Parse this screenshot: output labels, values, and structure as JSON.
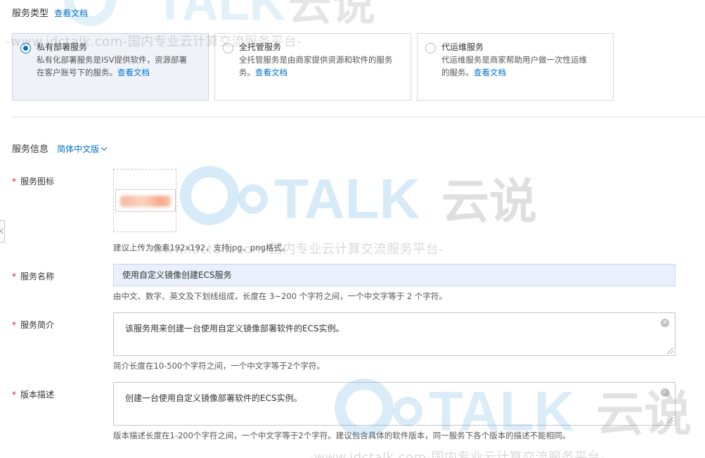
{
  "service_type": {
    "label": "服务类型",
    "doc_link": "查看文档",
    "options": [
      {
        "title": "私有部署服务",
        "line1": "私有化部署服务是ISV提供软件，资源部署",
        "line2": "在客户账号下的服务。",
        "link": "查看文档",
        "selected": true
      },
      {
        "title": "全托管服务",
        "line1": "全托管服务是由商家提供资源和软件的服务",
        "line2": "务。",
        "link": "查看文档",
        "selected": false
      },
      {
        "title": "代运维服务",
        "line1": "代运维服务是商家帮助用户做一次性运维",
        "line2": "的服务。",
        "link": "查看文档",
        "selected": false
      }
    ]
  },
  "service_info": {
    "label": "服务信息",
    "language": "简体中文版"
  },
  "form": {
    "icon": {
      "label": "服务图标",
      "hint": "建议上传为像素192x192，支持jpg、png格式。"
    },
    "name": {
      "label": "服务名称",
      "value": "使用自定义镜像创建ECS服务",
      "hint": "由中文、数字、英文及下划线组成，长度在 3~200 个字符之间，一个中文字等于 2 个字符。"
    },
    "summary": {
      "label": "服务简介",
      "value": "该服务用来创建一台使用自定义镜像部署软件的ECS实例。",
      "hint": "简介长度在10-500个字符之间，一个中文字等于2个字符。"
    },
    "version_desc": {
      "label": "版本描述",
      "value": "创建一台使用自定义镜像部署软件的ECS实例。",
      "hint": "版本描述长度在1-200个字符之间，一个中文字等于2个字符。建议包含具体的软件版本，同一服务下各个版本的描述不能相同。"
    }
  },
  "watermark": {
    "text": "-www.idctalk.com-国内专业云计算交流服务平台-",
    "logo_text": "TALK",
    "logo_cn": "云说"
  },
  "colors": {
    "accent": "#0070cc",
    "required": "#e02020",
    "selected_bg": "#eff3f8"
  }
}
